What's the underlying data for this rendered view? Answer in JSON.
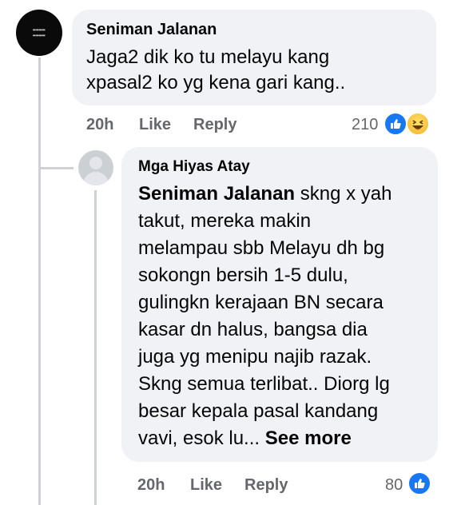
{
  "comment": {
    "author": "Seniman Jalanan",
    "text_line1": "Jaga2 dik ko tu melayu kang",
    "text_line2": "xpasal2 ko yg kena gari kang..",
    "time": "20h",
    "like_label": "Like",
    "reply_label": "Reply",
    "reaction_count": "210",
    "reactions": [
      "like-icon",
      "haha-icon"
    ]
  },
  "reply": {
    "author": "Mga Hiyas Atay",
    "mention": "Seniman Jalanan",
    "text_lines": [
      " skng x yah",
      "takut, mereka makin",
      "melampau sbb Melayu dh bg",
      "sokongn bersih 1-5 dulu,",
      "gulingkn kerajaan BN secara",
      "kasar dn halus, bangsa dia",
      "juga yg menipu najib razak.",
      "Skng semua terlibat.. Diorg lg",
      "besar kepala pasal kandang",
      "vavi, esok lu... "
    ],
    "see_more_label": "See more",
    "time": "20h",
    "like_label": "Like",
    "reply_label": "Reply",
    "reaction_count": "80",
    "reactions": [
      "like-icon"
    ]
  },
  "colors": {
    "bubble": "#f0f2f5",
    "meta": "#65676b",
    "like_blue": "#1877f2"
  }
}
